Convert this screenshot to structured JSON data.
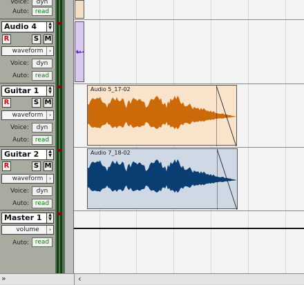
{
  "tracks": [
    {
      "id": "audio3-partial",
      "name": "",
      "voice_label": "Voice:",
      "voice_value": "dyn",
      "auto_label": "Auto:",
      "auto_value": "read"
    },
    {
      "id": "audio4",
      "name": "Audio 4",
      "r_label": "R",
      "s_label": "S",
      "m_label": "M",
      "view": "waveform",
      "voice_label": "Voice:",
      "voice_value": "dyn",
      "auto_label": "Auto:",
      "auto_value": "read"
    },
    {
      "id": "guitar1",
      "name": "Guitar 1",
      "r_label": "R",
      "s_label": "S",
      "m_label": "M",
      "view": "waveform",
      "voice_label": "Voice:",
      "voice_value": "dyn",
      "auto_label": "Auto:",
      "auto_value": "read"
    },
    {
      "id": "guitar2",
      "name": "Guitar 2",
      "r_label": "R",
      "s_label": "S",
      "m_label": "M",
      "view": "waveform",
      "voice_label": "Voice:",
      "voice_value": "dyn",
      "auto_label": "Auto:",
      "auto_value": "read"
    },
    {
      "id": "master1",
      "name": "Master 1",
      "view": "volume",
      "auto_label": "Auto:",
      "auto_value": "read"
    }
  ],
  "regions": [
    {
      "name": "Audio 5_17-02",
      "fill": "#f9e4cb",
      "wave": "#cc6a0a"
    },
    {
      "name": "Audio 7_18-02",
      "fill": "#cfd9e6",
      "wave": "#0a3e73"
    }
  ],
  "icons": {
    "spin": "spinner-arrows-icon",
    "dropdown": "chevron-right-icon",
    "scroll_left": "double-chevron-icon",
    "scroll_back": "chevron-left-icon"
  },
  "scroll": {
    "left_glyph": "»",
    "back_glyph": "‹"
  }
}
